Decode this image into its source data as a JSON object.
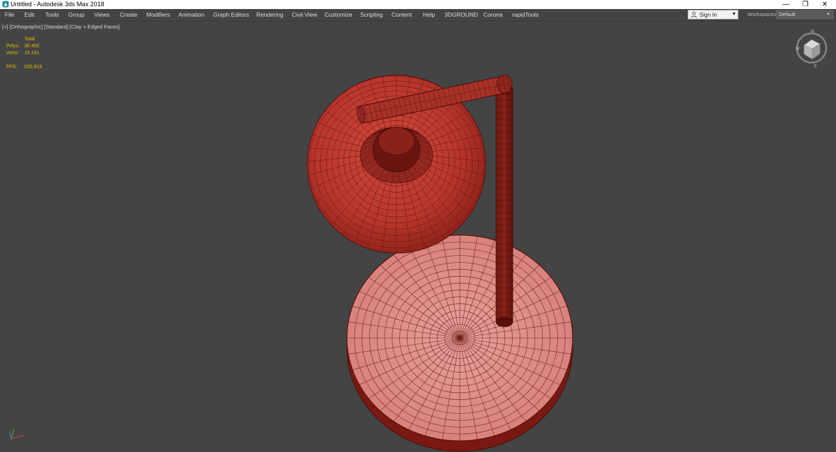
{
  "window": {
    "title": "Untitled - Autodesk 3ds Max 2018",
    "controls": {
      "minimize": "—",
      "restore": "❐",
      "close": "✕"
    }
  },
  "menu": {
    "items": [
      "File",
      "Edit",
      "Tools",
      "Group",
      "Views",
      "Create",
      "Modifiers",
      "Animation",
      "Graph Editors",
      "Rendering",
      "Civil View",
      "Customize",
      "Scripting",
      "Content",
      "Help",
      "3DGROUND",
      "Corona",
      "rapidTools"
    ]
  },
  "account": {
    "sign_in": "Sign In"
  },
  "workspaces": {
    "label": "Workspaces:",
    "value": "Default"
  },
  "viewport": {
    "label": "[+] [Orthographic] [Standard] [Clay + Edged Faces]",
    "stats": {
      "header": "Total",
      "polys_label": "Polys:",
      "polys_value": "30 400",
      "verts_label": "Verts:",
      "verts_value": "15 241",
      "fps_label": "FPS:",
      "fps_value": "535,619"
    }
  },
  "colors": {
    "viewport_bg": "#444444",
    "clay_dark": "#7a1a14",
    "clay_mid": "#b53a30",
    "clay_light": "#e48f8a",
    "stats_yellow": "#e0c000"
  }
}
